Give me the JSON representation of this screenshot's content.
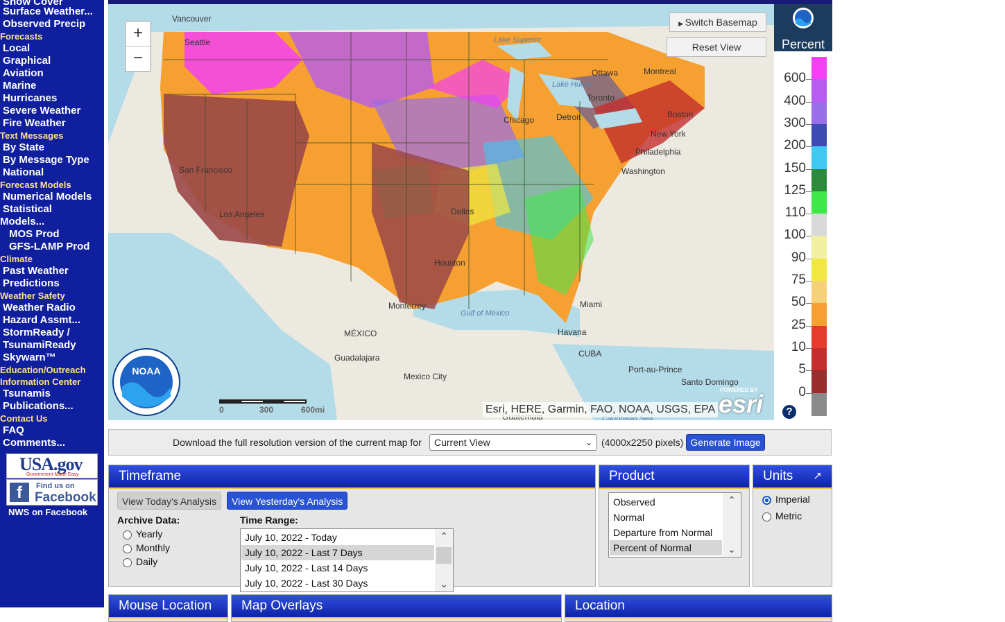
{
  "sidebar": {
    "items": [
      {
        "type": "item",
        "label": "Snow Cover"
      },
      {
        "type": "item",
        "label": "Surface Weather..."
      },
      {
        "type": "item",
        "label": "Observed Precip"
      },
      {
        "type": "section",
        "label": "Forecasts"
      },
      {
        "type": "item",
        "label": "Local"
      },
      {
        "type": "item",
        "label": "Graphical"
      },
      {
        "type": "item",
        "label": "Aviation"
      },
      {
        "type": "item",
        "label": "Marine"
      },
      {
        "type": "item",
        "label": "Hurricanes"
      },
      {
        "type": "item",
        "label": "Severe Weather"
      },
      {
        "type": "item",
        "label": "Fire Weather"
      },
      {
        "type": "section",
        "label": "Text Messages"
      },
      {
        "type": "item",
        "label": "By State"
      },
      {
        "type": "item",
        "label": "By Message Type"
      },
      {
        "type": "item",
        "label": "National"
      },
      {
        "type": "section",
        "label": "Forecast Models"
      },
      {
        "type": "item",
        "label": "Numerical Models"
      },
      {
        "type": "item",
        "label": "Statistical"
      },
      {
        "type": "item",
        "label": "Models..."
      },
      {
        "type": "item",
        "label": "MOS Prod"
      },
      {
        "type": "item",
        "label": "GFS-LAMP Prod"
      },
      {
        "type": "section",
        "label": "Climate"
      },
      {
        "type": "item",
        "label": "Past Weather"
      },
      {
        "type": "item",
        "label": "Predictions"
      },
      {
        "type": "section",
        "label": "Weather Safety"
      },
      {
        "type": "item",
        "label": "Weather Radio"
      },
      {
        "type": "item",
        "label": "Hazard Assmt..."
      },
      {
        "type": "item",
        "label": "StormReady /"
      },
      {
        "type": "item",
        "label": "TsunamiReady"
      },
      {
        "type": "item",
        "label": "Skywarn™"
      },
      {
        "type": "section",
        "label": "Education/Outreach"
      },
      {
        "type": "section",
        "label": "Information Center"
      },
      {
        "type": "item",
        "label": "Tsunamis"
      },
      {
        "type": "item",
        "label": "Publications..."
      },
      {
        "type": "section",
        "label": "Contact Us"
      },
      {
        "type": "item",
        "label": "FAQ"
      },
      {
        "type": "item",
        "label": "Comments..."
      }
    ],
    "usagov": {
      "title": "USA.gov",
      "tagline": "Government Made Easy"
    },
    "facebook": {
      "line1": "Find us on",
      "line2": "Facebook"
    },
    "nws_facebook": "NWS on Facebook"
  },
  "map": {
    "switch_basemap": "Switch Basemap",
    "reset_view": "Reset View",
    "zoom_in": "+",
    "zoom_out": "−",
    "attribution": "Esri, HERE, Garmin, FAO, NOAA, USGS, EPA",
    "esri_powered": "POWERED BY",
    "esri_logo": "esri",
    "noaa_logo_text": "NOAA",
    "scale": {
      "labels": [
        "0",
        "300",
        "600mi"
      ]
    },
    "place_labels": [
      "Vancouver",
      "Seattle",
      "San Francisco",
      "Los Angeles",
      "Ottawa",
      "Montreal",
      "Toronto",
      "Detroit",
      "Chicago",
      "Boston",
      "New York",
      "Philadelphia",
      "Washington",
      "Dallas",
      "Houston",
      "Monterrey",
      "Miami",
      "Havana",
      "MÉXICO",
      "Guadalajara",
      "Mexico City",
      "CUBA",
      "Port-au-Prince",
      "Santo Domingo",
      "Guatemala"
    ],
    "water_labels": [
      "Lake Superior",
      "Lake Huron",
      "Gulf of Mexico",
      "Caribbean Sea"
    ]
  },
  "legend": {
    "title": "Percent",
    "values": [
      "600",
      "400",
      "300",
      "200",
      "150",
      "125",
      "110",
      "100",
      "90",
      "75",
      "50",
      "25",
      "10",
      "5",
      "0"
    ],
    "colors": [
      "#f43ff4",
      "#b65cf0",
      "#9a6ee8",
      "#3e4bb5",
      "#3fc8f0",
      "#2d8a3a",
      "#3fe84a",
      "#d9d9d9",
      "#f0f0a0",
      "#f0e840",
      "#f5d27a",
      "#f5a030",
      "#e63a2e",
      "#c42e2e",
      "#9a2e2e",
      "#8a8a8a"
    ],
    "help": "?"
  },
  "download": {
    "text": "Download the full resolution version of the current map for",
    "select_value": "Current View",
    "pixels": "(4000x2250 pixels)",
    "button": "Generate Image"
  },
  "timeframe": {
    "title": "Timeframe",
    "tab_today": "View Today's Analysis",
    "tab_yesterday": "View Yesterday's Analysis",
    "archive_label": "Archive Data:",
    "archive_options": [
      "Yearly",
      "Monthly",
      "Daily"
    ],
    "range_label": "Time Range:",
    "range_options": [
      "July 10, 2022 - Today",
      "July 10, 2022 - Last 7 Days",
      "July 10, 2022 - Last 14 Days",
      "July 10, 2022 - Last 30 Days"
    ],
    "range_selected": 1
  },
  "product": {
    "title": "Product",
    "options": [
      "Observed",
      "Normal",
      "Departure from Normal",
      "Percent of Normal"
    ],
    "selected": 3
  },
  "units": {
    "title": "Units",
    "options": [
      "Imperial",
      "Metric"
    ],
    "selected": 0,
    "expand_icon": "↗"
  },
  "bottom_panels": [
    "Mouse Location",
    "Map Overlays",
    "Location"
  ]
}
